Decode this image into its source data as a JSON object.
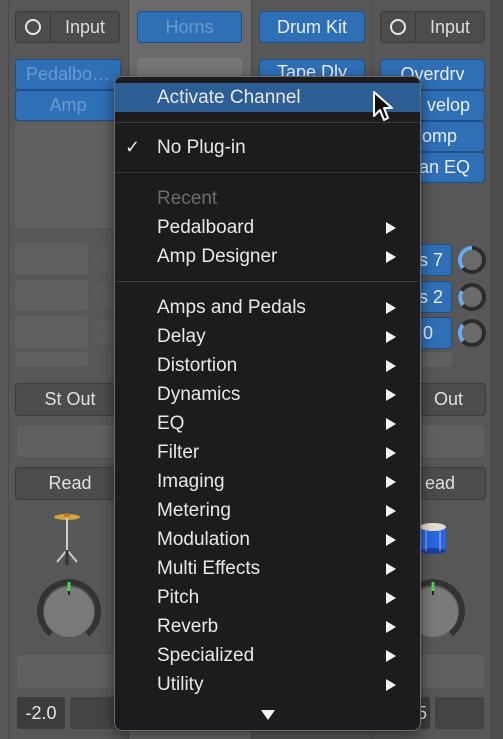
{
  "channels": [
    {
      "id": "ch1",
      "input": {
        "icon": "input-ring-icon",
        "label": "Input"
      },
      "plugins": [
        "Pedalbo…",
        "Amp"
      ],
      "output": "St Out",
      "automation": "Read",
      "instrument_icon": "cymbal-icon",
      "volume": "-2.0"
    },
    {
      "id": "ch2",
      "name": "Horns"
    },
    {
      "id": "ch3",
      "name": "Drum Kit",
      "plugins": [
        "Tape Dly"
      ]
    },
    {
      "id": "ch4",
      "input": {
        "icon": "input-ring-icon",
        "label": "Input"
      },
      "plugins": [
        "Overdrv",
        "velop",
        "omp",
        "an EQ"
      ],
      "sends": [
        "s 7",
        "s 2",
        "0"
      ],
      "output": "Out",
      "automation": "ead",
      "instrument_icon": "drum-icon",
      "volume": "5"
    }
  ],
  "menu": {
    "highlighted": "Activate Channel",
    "items": [
      {
        "label": "Activate Channel",
        "type": "item",
        "highlighted": true
      },
      {
        "label": "No Plug-in",
        "type": "item",
        "checked": true,
        "check": "✓"
      },
      {
        "label": "Recent",
        "type": "header"
      },
      {
        "label": "Pedalboard",
        "type": "submenu"
      },
      {
        "label": "Amp Designer",
        "type": "submenu"
      },
      {
        "label": "Amps and Pedals",
        "type": "submenu"
      },
      {
        "label": "Delay",
        "type": "submenu"
      },
      {
        "label": "Distortion",
        "type": "submenu"
      },
      {
        "label": "Dynamics",
        "type": "submenu"
      },
      {
        "label": "EQ",
        "type": "submenu"
      },
      {
        "label": "Filter",
        "type": "submenu"
      },
      {
        "label": "Imaging",
        "type": "submenu"
      },
      {
        "label": "Metering",
        "type": "submenu"
      },
      {
        "label": "Modulation",
        "type": "submenu"
      },
      {
        "label": "Multi Effects",
        "type": "submenu"
      },
      {
        "label": "Pitch",
        "type": "submenu"
      },
      {
        "label": "Reverb",
        "type": "submenu"
      },
      {
        "label": "Specialized",
        "type": "submenu"
      },
      {
        "label": "Utility",
        "type": "submenu"
      }
    ],
    "scroll_indicator": "scroll-down-arrow"
  },
  "colors": {
    "accent_blue": "#2f6fb5",
    "menu_highlight": "#2c5d93",
    "read_green": "#54d05a",
    "send_knob": "#6aa9f0"
  }
}
